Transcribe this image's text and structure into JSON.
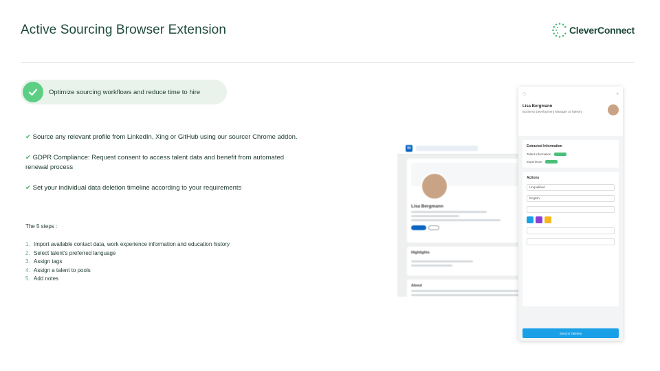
{
  "header": {
    "title": "Active Sourcing Browser Extension",
    "logo_text": "CleverConnect"
  },
  "highlight": {
    "text": "Optimize sourcing workflows and reduce time to hire",
    "icon": "check-icon",
    "color": "#5ccf85"
  },
  "bullets": [
    {
      "tick": "✔",
      "bold": "Source any relevant profile from LinkedIn, Xing or GitHub",
      "rest": " using our sourcer Chrome addon."
    },
    {
      "tick": "✔",
      "bold": "GDPR Compliance:",
      "rest": " Request consent to access talent data and benefit from automated renewal process"
    },
    {
      "tick": "✔",
      "bold": "Set your individual data deletion timeline",
      "rest": " according to your requirements"
    }
  ],
  "steps": {
    "title": "The 5 steps :",
    "items": [
      {
        "num": "1.",
        "text": "Import available contact data, work experience information and education history"
      },
      {
        "num": "2.",
        "text": "Select talent's preferred language"
      },
      {
        "num": "3.",
        "text": "Assign tags"
      },
      {
        "num": "4.",
        "text": "Assign a talent to pools"
      },
      {
        "num": "5.",
        "text": "Add notes"
      }
    ]
  },
  "mockup": {
    "profile": {
      "name": "Lisa Bergmann",
      "highlights": "Highlights",
      "about": "About"
    },
    "panel": {
      "name": "Lisa Bergmann",
      "role": "Business Development Manager at Talentry",
      "extracted_title": "Extracted Information",
      "talent_info": "Talent information",
      "experience": "Experience",
      "actions_title": "Actions",
      "status_value": "Unqualified",
      "language_value": "English",
      "send_label": "Send to Talentry"
    }
  },
  "colors": {
    "accent_green": "#4bb36a",
    "linkedin_blue": "#0a66c2",
    "send_blue": "#1aa0e6"
  }
}
